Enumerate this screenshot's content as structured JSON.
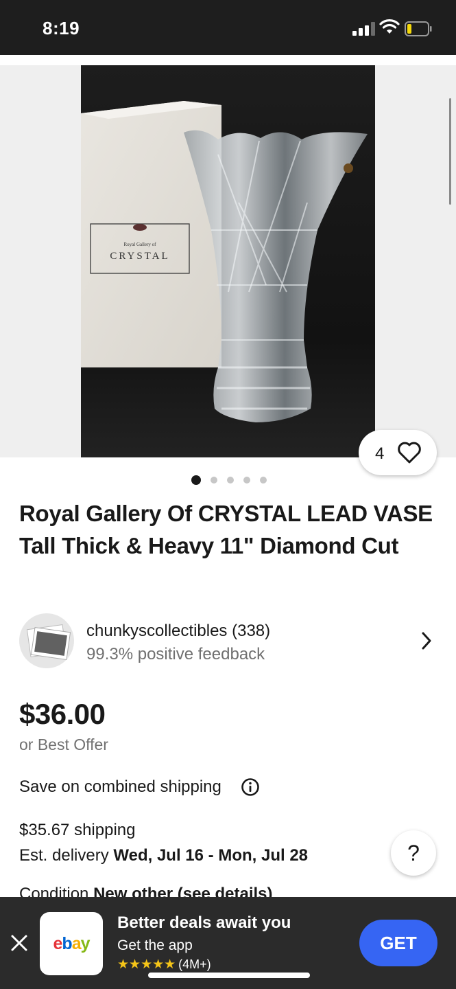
{
  "status_bar": {
    "time": "8:19"
  },
  "product": {
    "favorites_count": "4",
    "image_dot_count": 5,
    "active_image_index": 0,
    "title": "Royal Gallery Of CRYSTAL LEAD VASE Tall Thick & Heavy 11\" Diamond Cut",
    "box_label_small": "Royal Gallery of",
    "box_label_large": "CRYSTAL"
  },
  "seller": {
    "name_with_score": "chunkyscollectibles (338)",
    "feedback": "99.3% positive feedback"
  },
  "pricing": {
    "price": "$36.00",
    "offer_text": "or Best Offer",
    "combined_shipping": "Save on combined shipping",
    "shipping": "$35.67 shipping",
    "delivery_prefix": "Est. delivery ",
    "delivery_dates": "Wed, Jul 16 - Mon, Jul 28"
  },
  "condition": {
    "label": "Condition",
    "value": "New other (see details)"
  },
  "help": {
    "label": "?"
  },
  "app_banner": {
    "title": "Better deals await you",
    "subtitle": "Get the app",
    "stars": "★★★★★",
    "rating_count": "(4M+)",
    "cta": "GET",
    "logo_e": "e",
    "logo_b": "b",
    "logo_a": "a",
    "logo_y": "y",
    "colors": {
      "e": "#e53238",
      "b": "#0064d2",
      "a": "#f5af02",
      "y": "#86b817",
      "cta_bg": "#3665f3"
    }
  }
}
